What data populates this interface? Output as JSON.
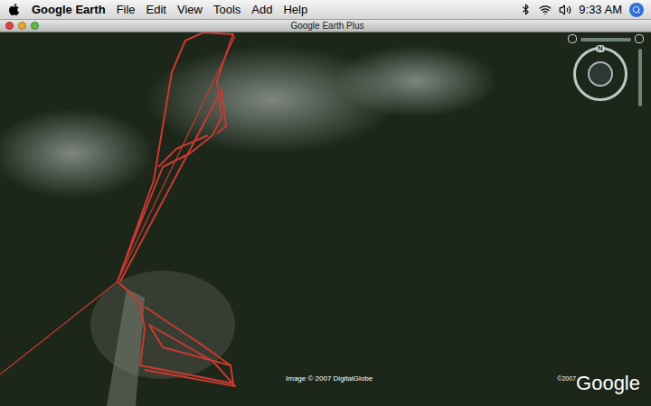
{
  "menu_bar": {
    "app": "Google Earth",
    "items": [
      "File",
      "Edit",
      "View",
      "Tools",
      "Add",
      "Help"
    ],
    "clock": "9:33 AM"
  },
  "window": {
    "title": "Google Earth Plus"
  },
  "map": {
    "attribution": "Image © 2007 DigitalGlobe",
    "logo_year": "©2007",
    "logo": "Google"
  },
  "navigation": {
    "north": "N"
  }
}
